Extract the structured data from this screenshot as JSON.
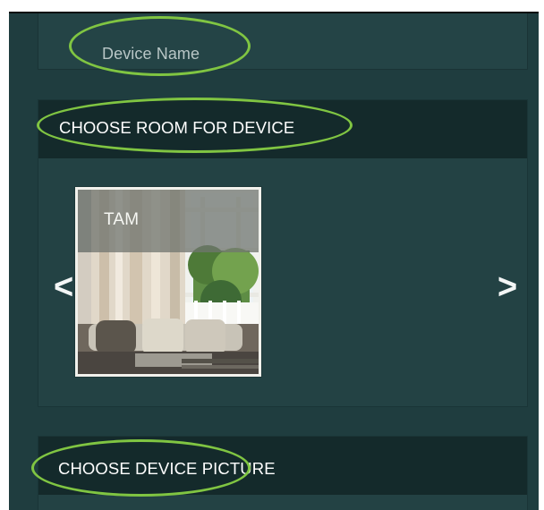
{
  "device": {
    "name_label": "Device Name"
  },
  "room_section": {
    "title": "CHOOSE ROOM FOR DEVICE",
    "previous_icon": "<",
    "next_icon": ">",
    "selected_room": {
      "label": "TAM"
    }
  },
  "picture_section": {
    "title": "CHOOSE DEVICE PICTURE"
  },
  "colors": {
    "app_background": "#1f3d3f",
    "section_header": "#142a2b",
    "highlight": "#80c542",
    "text_primary": "#ffffff",
    "text_muted": "#b8c6c6"
  },
  "icons": {
    "previous": "chevron-left-icon",
    "next": "chevron-right-icon",
    "room_photo": "living-room-photo"
  }
}
